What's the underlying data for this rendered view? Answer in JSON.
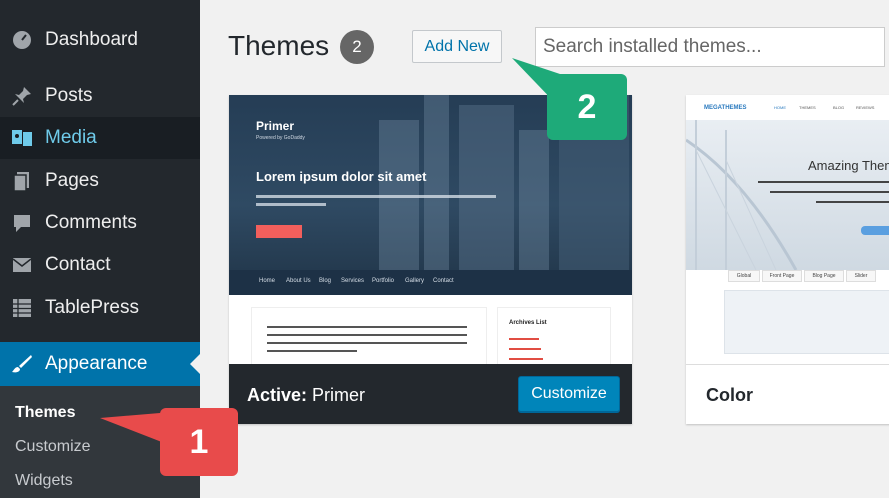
{
  "sidebar": {
    "items": [
      {
        "label": "Dashboard",
        "icon": "dashboard-icon"
      },
      {
        "label": "Posts",
        "icon": "pin-icon"
      },
      {
        "label": "Media",
        "icon": "media-icon"
      },
      {
        "label": "Pages",
        "icon": "pages-icon"
      },
      {
        "label": "Comments",
        "icon": "comment-icon"
      },
      {
        "label": "Contact",
        "icon": "mail-icon"
      },
      {
        "label": "TablePress",
        "icon": "table-icon"
      },
      {
        "label": "Appearance",
        "icon": "brush-icon"
      }
    ],
    "submenu": [
      "Themes",
      "Customize",
      "Widgets"
    ],
    "accent_color": "#0073aa"
  },
  "header": {
    "title": "Themes",
    "count": "2",
    "add_new_label": "Add New",
    "search_placeholder": "Search installed themes..."
  },
  "themes": [
    {
      "name": "Primer",
      "active_prefix": "Active:",
      "customize_label": "Customize",
      "preview": {
        "logo": "Primer",
        "tagline": "Powered by GoDaddy",
        "headline": "Lorem ipsum dolor sit amet",
        "nav": [
          "Home",
          "About Us",
          "Blog",
          "Services",
          "Portfolio",
          "Gallery",
          "Contact"
        ],
        "sidebar_title": "Archives List"
      }
    },
    {
      "name": "Color",
      "preview": {
        "logo": "MEGATHEMES",
        "nav": [
          "HOME",
          "THEMES",
          "BLOG",
          "REVIEWS"
        ],
        "headline": "Amazing Them",
        "tabs": [
          "Global",
          "Front Page",
          "Blog Page",
          "Slider"
        ]
      }
    }
  ],
  "annotations": {
    "callout_1": "1",
    "callout_2": "2",
    "callout_1_color": "#e84b4b",
    "callout_2_color": "#1eaa79"
  }
}
